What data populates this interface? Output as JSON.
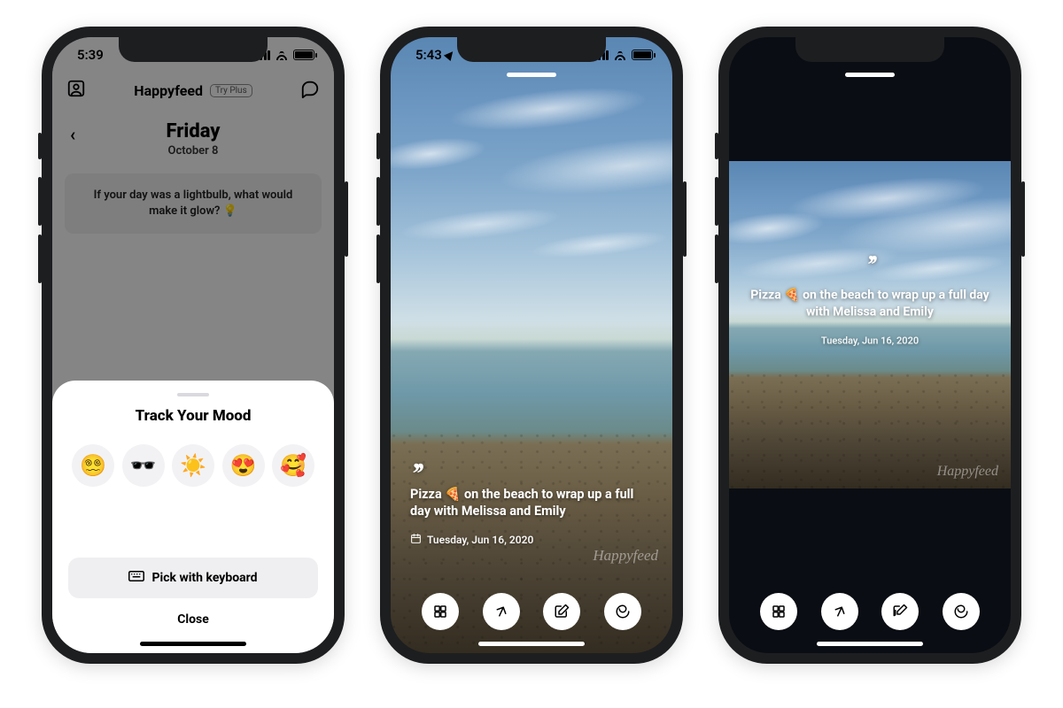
{
  "phone1": {
    "status_time": "5:39",
    "header_title": "Happyfeed",
    "try_plus": "Try Plus",
    "day": "Friday",
    "date": "October 8",
    "prompt": "If your day was a lightbulb, what would make it glow? 💡",
    "sheet_title": "Track Your Mood",
    "emojis": [
      "😵‍💫",
      "🕶️",
      "☀️",
      "😍",
      "🥰"
    ],
    "keyboard_btn": "Pick with keyboard",
    "close_btn": "Close"
  },
  "phone2": {
    "status_time": "5:43",
    "caption_pre": "Pizza ",
    "caption_emoji": "🍕",
    "caption_post": " on the beach to wrap up a full day with Melissa and Emily",
    "date": "Tuesday, Jun 16, 2020",
    "watermark": "Happyfeed"
  },
  "phone3": {
    "caption_pre": "Pizza ",
    "caption_emoji": "🍕",
    "caption_post": " on the beach to wrap up a full day with Melissa and Emily",
    "date": "Tuesday, Jun 16, 2020",
    "watermark": "Happyfeed"
  },
  "actions": [
    "grid",
    "send",
    "edit",
    "spiral"
  ]
}
